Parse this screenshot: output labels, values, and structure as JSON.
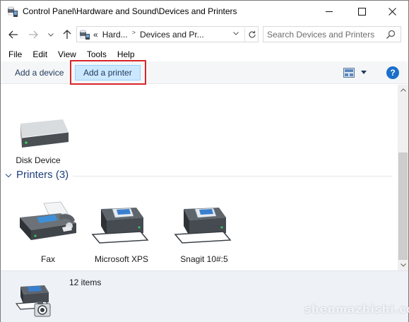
{
  "window": {
    "title": "Control Panel\\Hardware and Sound\\Devices and Printers"
  },
  "nav": {
    "crumb_prefix": "«",
    "crumbs": [
      "Hard...",
      "Devices and Pr..."
    ],
    "search_placeholder": "Search Devices and Printers"
  },
  "menu": [
    "File",
    "Edit",
    "View",
    "Tools",
    "Help"
  ],
  "commands": {
    "add_device": "Add a device",
    "add_printer": "Add a printer",
    "help": "?"
  },
  "devices": [
    {
      "label": "Disk Device",
      "icon": "disk-drive-icon"
    }
  ],
  "printers_group": {
    "title": "Printers (3)",
    "items": [
      {
        "label": "Fax",
        "icon": "fax-icon"
      },
      {
        "label": "Microsoft XPS",
        "icon": "printer-icon"
      },
      {
        "label": "Snagit 10#:5",
        "icon": "printer-icon"
      }
    ]
  },
  "details": {
    "count": "12 items",
    "icon": "printer-camera-icon"
  },
  "watermark": "shenmazhishi.com",
  "colors": {
    "highlight_border": "#d9252a",
    "selected_button": "#cce8ff",
    "group_title": "#1e3f7a",
    "details_bg": "#eef1f6"
  }
}
